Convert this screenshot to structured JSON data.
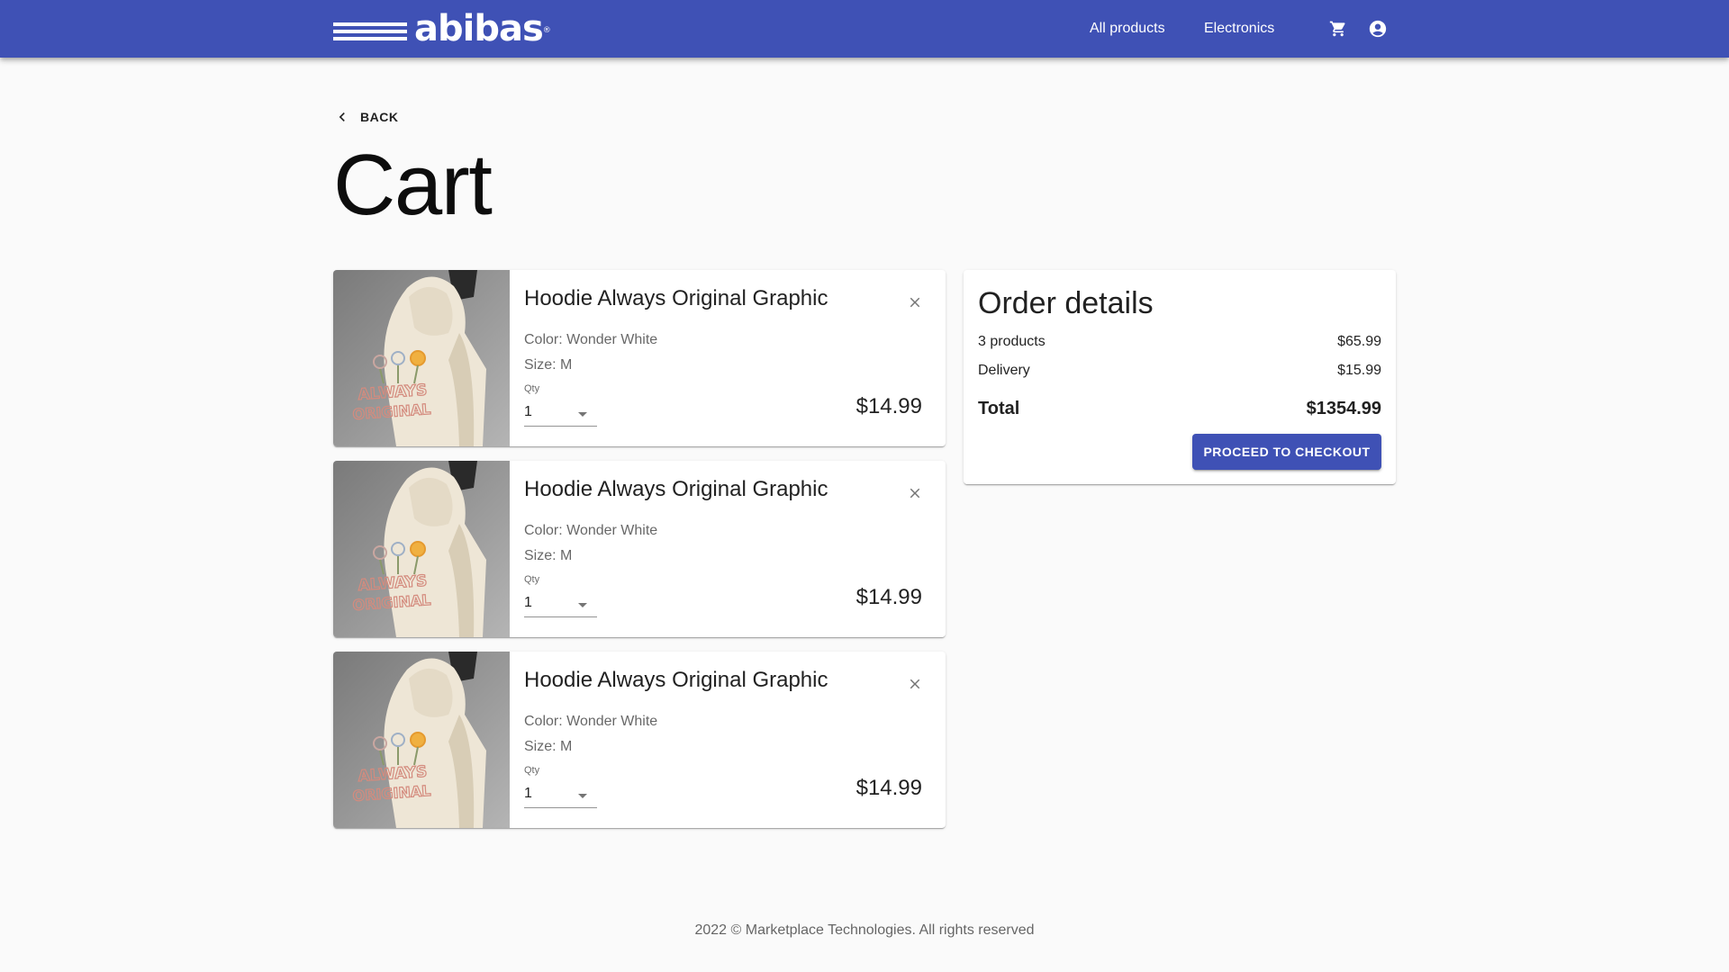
{
  "header": {
    "logo_text": "abibas",
    "logo_mark": "®",
    "nav": [
      "All products",
      "Electronics"
    ],
    "icons": [
      "cart-icon",
      "account-circle-icon"
    ],
    "color": "#3f51b5"
  },
  "back_label": "BACK",
  "page_title": "Cart",
  "cart": {
    "items": [
      {
        "name": "Hoodie Always Original Graphic",
        "color": "Color: Wonder White",
        "size": "Size: M",
        "qty_label": "Qty",
        "qty": "1",
        "price": "$14.99",
        "image_text": [
          "ALWAYS",
          "ORIGINAL"
        ]
      },
      {
        "name": "Hoodie Always Original Graphic",
        "color": "Color: Wonder White",
        "size": "Size: M",
        "qty_label": "Qty",
        "qty": "1",
        "price": "$14.99",
        "image_text": [
          "ALWAYS",
          "ORIGINAL"
        ]
      },
      {
        "name": "Hoodie Always Original Graphic",
        "color": "Color: Wonder White",
        "size": "Size: M",
        "qty_label": "Qty",
        "qty": "1",
        "price": "$14.99",
        "image_text": [
          "ALWAYS",
          "ORIGINAL"
        ]
      }
    ]
  },
  "order": {
    "title": "Order details",
    "products_label": "3 products",
    "products_value": "$65.99",
    "delivery_label": "Delivery",
    "delivery_value": "$15.99",
    "total_label": "Total",
    "total_value": "$1354.99",
    "checkout_label": "PROCEED TO CHECKOUT"
  },
  "footer": "2022 © Marketplace Technologies. All rights reserved"
}
